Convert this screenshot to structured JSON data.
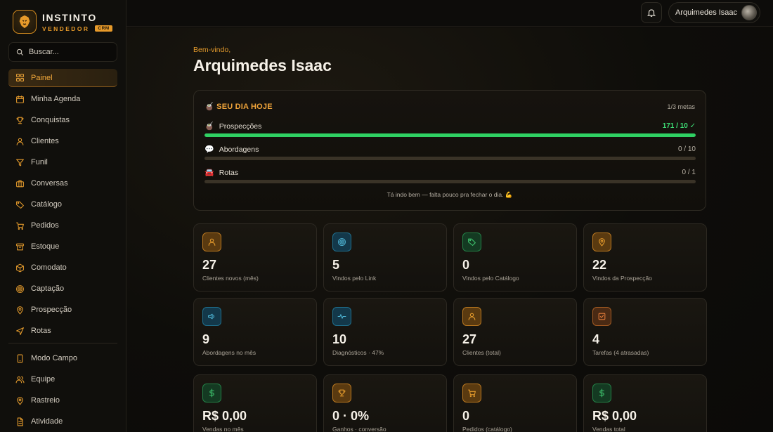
{
  "brand": {
    "name": "INSTINTO",
    "sub": "VENDEDOR",
    "badge": "CRM"
  },
  "search": {
    "placeholder": "Buscar..."
  },
  "nav": {
    "items": [
      {
        "label": "Painel",
        "icon": "grid-icon",
        "active": true
      },
      {
        "label": "Minha Agenda",
        "icon": "calendar-icon"
      },
      {
        "label": "Conquistas",
        "icon": "trophy-icon"
      },
      {
        "label": "Clientes",
        "icon": "user-icon"
      },
      {
        "label": "Funil",
        "icon": "funnel-icon"
      },
      {
        "label": "Conversas",
        "icon": "briefcase-icon"
      },
      {
        "label": "Catálogo",
        "icon": "tag-icon"
      },
      {
        "label": "Pedidos",
        "icon": "cart-icon"
      },
      {
        "label": "Estoque",
        "icon": "box-icon"
      },
      {
        "label": "Comodato",
        "icon": "package-icon"
      },
      {
        "label": "Captação",
        "icon": "target-icon"
      },
      {
        "label": "Prospecção",
        "icon": "pin-icon"
      },
      {
        "label": "Rotas",
        "icon": "navigation-icon"
      }
    ],
    "items2": [
      {
        "label": "Modo Campo",
        "icon": "phone-icon"
      },
      {
        "label": "Equipe",
        "icon": "team-icon"
      },
      {
        "label": "Rastreio",
        "icon": "location-icon"
      },
      {
        "label": "Atividade",
        "icon": "document-icon"
      }
    ]
  },
  "topbar": {
    "user_name": "Arquimedes Isaac"
  },
  "main": {
    "welcome": "Bem-vindo,",
    "title": "Arquimedes Isaac"
  },
  "day": {
    "heading": "🧉 SEU DIA HOJE",
    "meta": "1/3 metas",
    "goals": [
      {
        "emoji": "🧉",
        "label": "Prospecções",
        "value": "171 / 10 ✓",
        "progress": 1.0,
        "done": true
      },
      {
        "emoji": "💬",
        "label": "Abordagens",
        "value": "0 / 10",
        "progress": 0
      },
      {
        "emoji": "🚘",
        "label": "Rotas",
        "value": "0 / 1",
        "progress": 0
      }
    ],
    "footer": "Tá indo bem — falta pouco pra fechar o dia. 💪"
  },
  "stats": [
    {
      "value": "27",
      "label": "Clientes novos (mês)",
      "icon": "user-icon",
      "tone": "amber",
      "color": "#e39a2c"
    },
    {
      "value": "5",
      "label": "Vindos pelo Link",
      "icon": "target-icon",
      "tone": "blue",
      "color": "#4fb6d6"
    },
    {
      "value": "0",
      "label": "Vindos pelo Catálogo",
      "icon": "tag-icon",
      "tone": "green",
      "color": "#3fc46e"
    },
    {
      "value": "22",
      "label": "Vindos da Prospecção",
      "icon": "pin-icon",
      "tone": "amber",
      "color": "#e39a2c"
    },
    {
      "value": "9",
      "label": "Abordagens no mês",
      "icon": "megaphone-icon",
      "tone": "blue",
      "color": "#4fb6d6"
    },
    {
      "value": "10",
      "label": "Diagnósticos · 47%",
      "icon": "pulse-icon",
      "tone": "blue",
      "color": "#4fb6d6"
    },
    {
      "value": "27",
      "label": "Clientes (total)",
      "icon": "user-icon",
      "tone": "amber",
      "color": "#e39a2c"
    },
    {
      "value": "4",
      "label": "Tarefas (4 atrasadas)",
      "icon": "checkbox-icon",
      "tone": "brown",
      "color": "#e07a3a"
    },
    {
      "value": "R$ 0,00",
      "label": "Vendas no mês",
      "icon": "dollar-icon",
      "tone": "green",
      "color": "#3fc46e"
    },
    {
      "value": "0 · 0%",
      "label": "Ganhos · conversão",
      "icon": "trophy-icon",
      "tone": "amber",
      "color": "#e39a2c"
    },
    {
      "value": "0",
      "label": "Pedidos (catálogo)",
      "icon": "cart-icon",
      "tone": "amber",
      "color": "#e39a2c"
    },
    {
      "value": "R$ 0,00",
      "label": "Vendas total",
      "icon": "dollar-icon",
      "tone": "green",
      "color": "#3fc46e"
    }
  ]
}
